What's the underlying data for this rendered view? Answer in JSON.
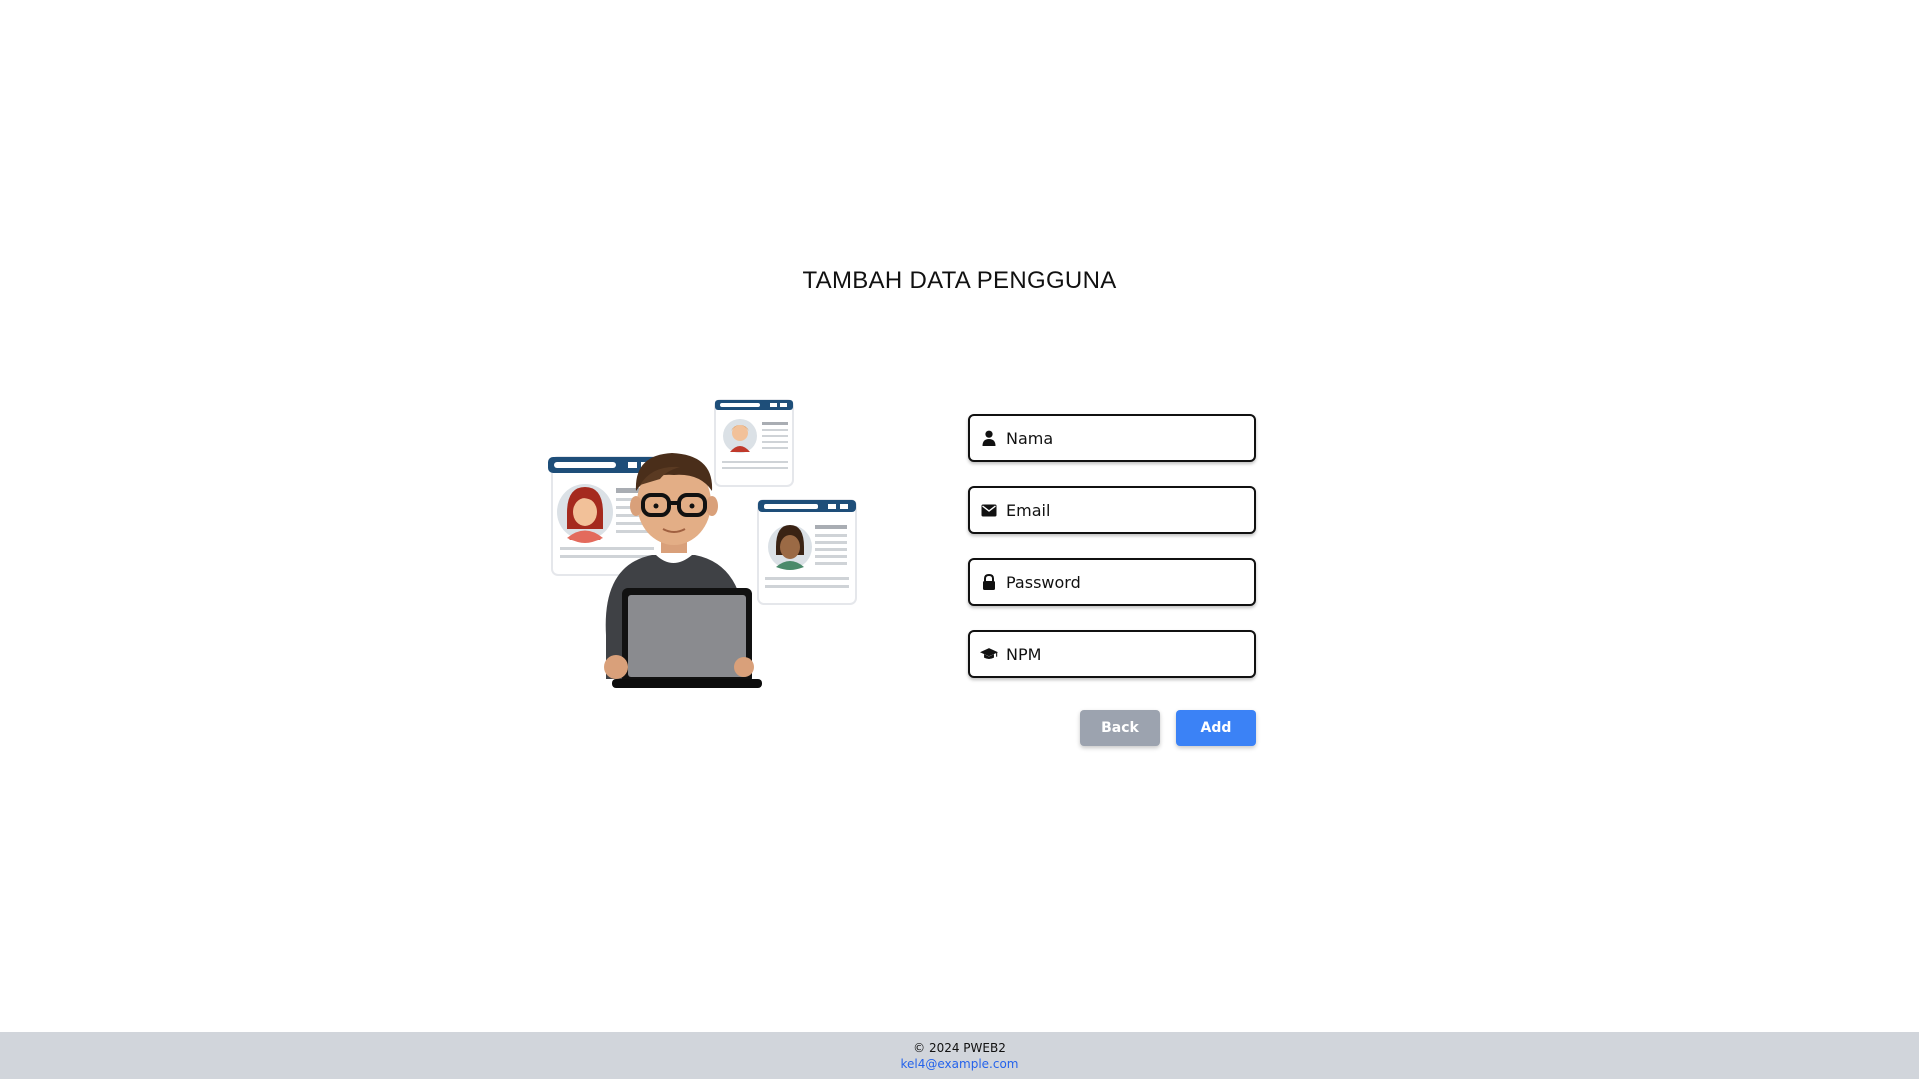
{
  "page": {
    "title": "TAMBAH DATA PENGGUNA"
  },
  "form": {
    "fields": [
      {
        "placeholder": "Nama",
        "value": "",
        "icon": "user-icon"
      },
      {
        "placeholder": "Email",
        "value": "",
        "icon": "envelope-icon"
      },
      {
        "placeholder": "Password",
        "value": "",
        "icon": "lock-icon"
      },
      {
        "placeholder": "NPM",
        "value": "",
        "icon": "graduation-cap-icon"
      }
    ]
  },
  "buttons": {
    "back_label": "Back",
    "add_label": "Add"
  },
  "footer": {
    "copyright": "© 2024 PWEB2",
    "email": "kel4@example.com"
  },
  "colors": {
    "primary": "#3b82f6",
    "secondary": "#9ca3af",
    "footer_bg": "#d1d5db",
    "link": "#2563eb"
  }
}
